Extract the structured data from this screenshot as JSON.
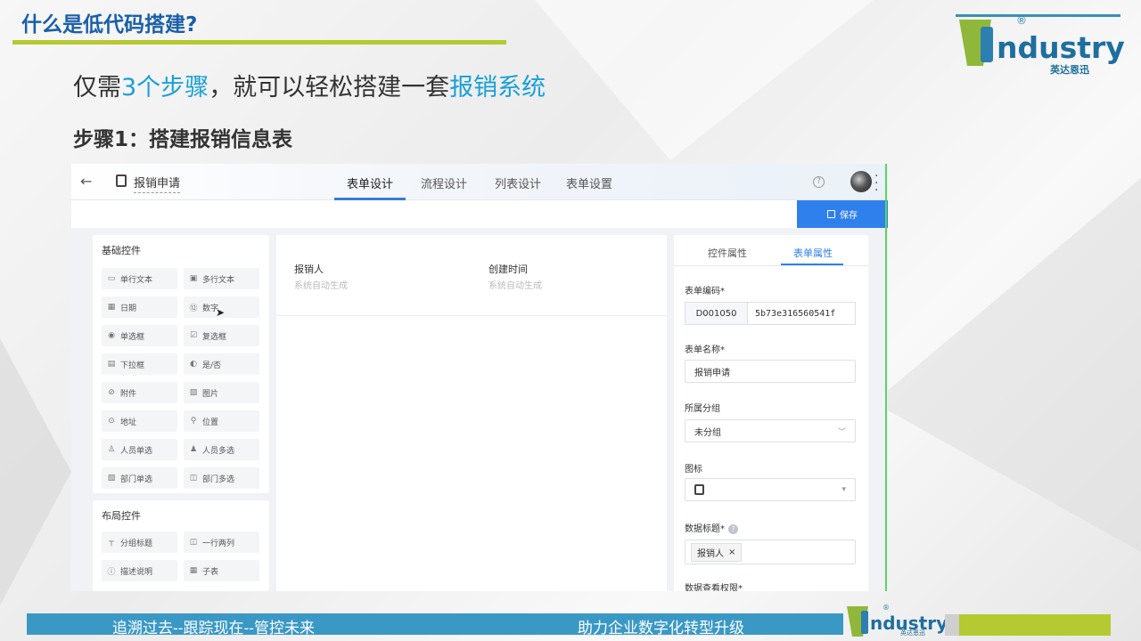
{
  "slide": {
    "title": "什么是低代码搭建?",
    "subtitle_pre": "仅需",
    "subtitle_hl1": "3个步骤",
    "subtitle_mid": "，就可以轻松搭建一套",
    "subtitle_hl2": "报销系统",
    "step_title": "步骤1：搭建报销信息表"
  },
  "logo": {
    "word": "ndustry",
    "cn": "英达恩迅",
    "reg": "®"
  },
  "app": {
    "back_icon": "←",
    "app_name": "报销申请",
    "tabs": [
      "表单设计",
      "流程设计",
      "列表设计",
      "表单设置"
    ],
    "active_tab": 0,
    "help_icon": "?",
    "save_label": "保存"
  },
  "palette": {
    "basic_title": "基础控件",
    "basic": [
      {
        "icon": "▭",
        "label": "单行文本"
      },
      {
        "icon": "▣",
        "label": "多行文本"
      },
      {
        "icon": "▦",
        "label": "日期"
      },
      {
        "icon": "⑫",
        "label": "数字"
      },
      {
        "icon": "◉",
        "label": "单选框"
      },
      {
        "icon": "☑",
        "label": "复选框"
      },
      {
        "icon": "▤",
        "label": "下拉框"
      },
      {
        "icon": "◐",
        "label": "是/否"
      },
      {
        "icon": "⊘",
        "label": "附件"
      },
      {
        "icon": "▨",
        "label": "图片"
      },
      {
        "icon": "⊙",
        "label": "地址"
      },
      {
        "icon": "⚲",
        "label": "位置"
      },
      {
        "icon": "♙",
        "label": "人员单选"
      },
      {
        "icon": "♟",
        "label": "人员多选"
      },
      {
        "icon": "▧",
        "label": "部门单选"
      },
      {
        "icon": "◫",
        "label": "部门多选"
      }
    ],
    "layout_title": "布局控件",
    "layout": [
      {
        "icon": "┬",
        "label": "分组标题"
      },
      {
        "icon": "◫",
        "label": "一行两列"
      },
      {
        "icon": "ⓘ",
        "label": "描述说明"
      },
      {
        "icon": "▦",
        "label": "子表"
      }
    ]
  },
  "canvas": {
    "fields": [
      {
        "label": "报销人",
        "placeholder": "系统自动生成"
      },
      {
        "label": "创建时间",
        "placeholder": "系统自动生成"
      }
    ]
  },
  "props": {
    "tabs": [
      "控件属性",
      "表单属性"
    ],
    "active_tab": 1,
    "code_label": "表单编码*",
    "code_prefix": "D001050",
    "code_value": "5b73e316560541f",
    "name_label": "表单名称*",
    "name_value": "报销申请",
    "group_label": "所属分组",
    "group_value": "未分组",
    "icon_label": "图标",
    "data_title_label": "数据标题*",
    "data_title_tag": "报销人",
    "tag_close": "×",
    "perm_label": "数据查看权限*"
  },
  "footer": {
    "left": "追溯过去--跟踪现在--管控未来",
    "right": "助力企业数字化转型升级",
    "logo_word": "ndustry",
    "logo_cn": "英达恩迅",
    "logo_reg": "®"
  },
  "colors": {
    "title_blue": "#1a5fa8",
    "accent_green": "#b5c930",
    "highlight_blue": "#1aa0d8",
    "primary_button": "#2f80ed",
    "footer_blue": "#3a98c5"
  }
}
